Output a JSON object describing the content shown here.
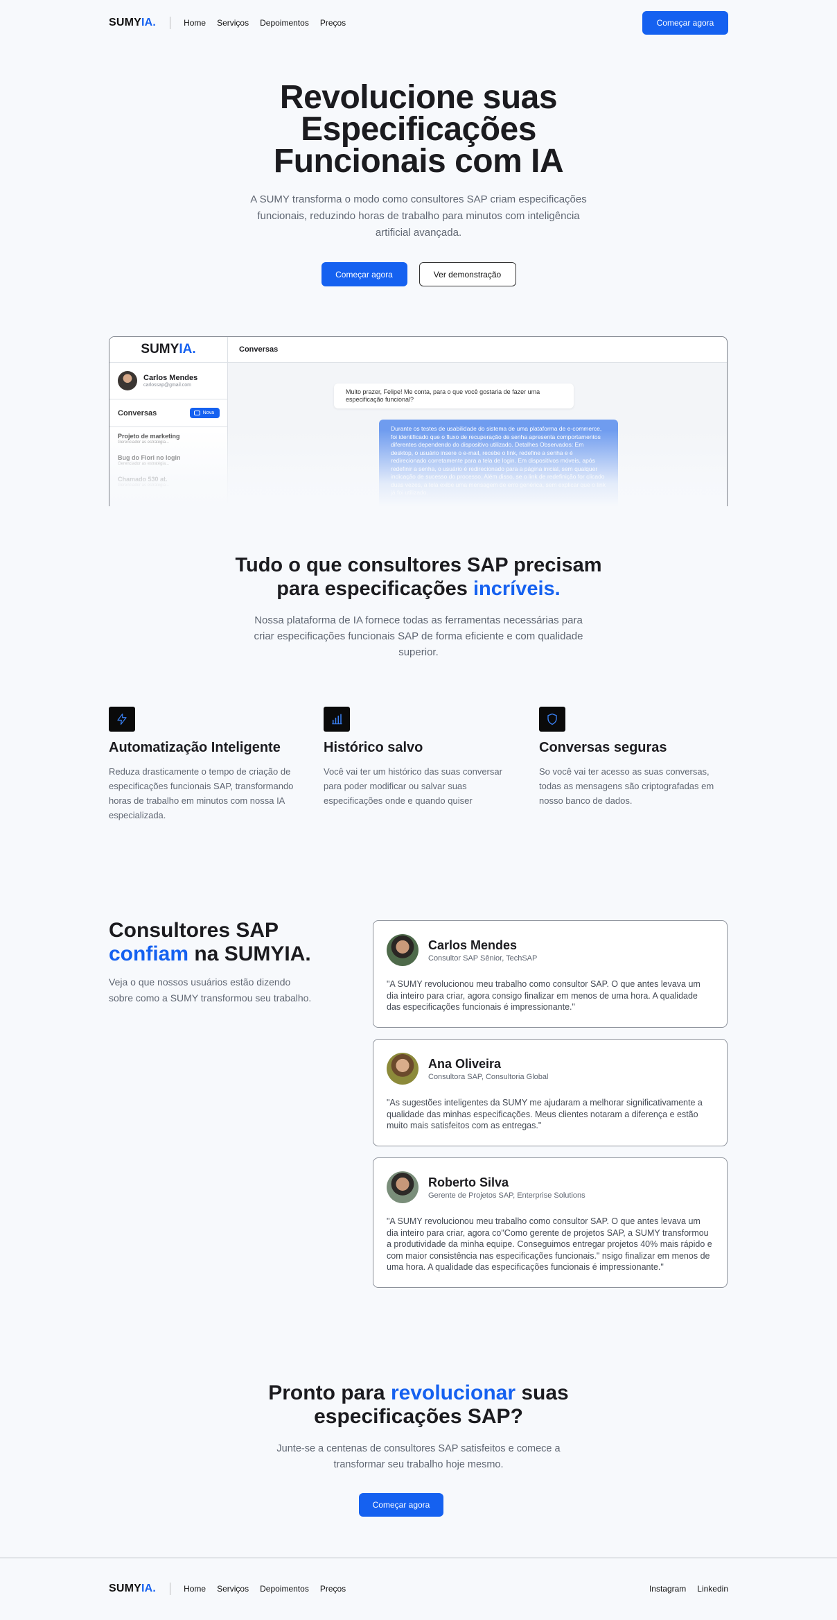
{
  "brand": {
    "name_main": "SUMY",
    "name_accent": "IA."
  },
  "colors": {
    "accent": "#1561f0",
    "background": "#f7f9fc",
    "text": "#1b1b1f",
    "muted": "#5f6672"
  },
  "nav": {
    "links": [
      "Home",
      "Serviços",
      "Depoimentos",
      "Preços"
    ],
    "cta": "Começar agora"
  },
  "hero": {
    "title_line1": "Revolucione suas",
    "title_line2": "Especificações",
    "title_line3": "Funcionais com IA",
    "subtitle": "A SUMY transforma o modo como consultores SAP criam especificações funcionais, reduzindo horas de trabalho para minutos com inteligência artificial avançada.",
    "primary_button": "Começar agora",
    "secondary_button": "Ver demonstração"
  },
  "app_preview": {
    "logo_main": "SUMY",
    "logo_accent": "IA.",
    "header_title": "Conversas",
    "user": {
      "name": "Carlos Mendes",
      "email": "carlossap@gmail.com"
    },
    "conversations_label": "Conversas",
    "new_button": "Nova",
    "conversations": [
      {
        "title": "Projeto de marketing",
        "desc": "Gerenciador as estratégia..."
      },
      {
        "title": "Bug do Fiori no login",
        "desc": "Gerenciador as estratégia..."
      },
      {
        "title": "Chamado 530 at.",
        "desc": "Gerenciador as estratégia..."
      }
    ],
    "message_in": "Muito prazer, Felipe! Me conta, para o que você gostaria de fazer uma especificação funcional?",
    "message_out": "Durante os testes de usabilidade do sistema de uma plataforma de e-commerce, foi identificado que o fluxo de recuperação de senha apresenta comportamentos diferentes dependendo do dispositivo utilizado. Detalhes Observados: Em desktop, o usuário insere o e-mail, recebe o link, redefine a senha e é redirecionado corretamente para a tela de login. Em dispositivos móveis, após redefinir a senha, o usuário é redirecionado para a página inicial, sem qualquer indicação de sucesso do processo. Além disso, se o link de redefinição for clicado duas vezes, a tela exibe uma mensagem de erro genérica, sem explicar que o link já foi utilizado."
  },
  "features_section": {
    "title_line1": "Tudo o que consultores SAP precisam",
    "title_line2_prefix": "para especificações ",
    "title_line2_accent": "incríveis.",
    "subtitle": "Nossa plataforma de IA fornece todas as ferramentas necessárias para criar especificações funcionais SAP de forma eficiente e com qualidade superior.",
    "items": [
      {
        "icon": "lightning-icon",
        "title": "Automatização Inteligente",
        "text": "Reduza drasticamente o tempo de criação de especificações funcionais SAP, transformando horas de trabalho em minutos com nossa IA especializada."
      },
      {
        "icon": "bar-chart-icon",
        "title": "Histórico salvo",
        "text": "Você vai ter um histórico das suas conversar para poder modificar ou salvar suas especificações onde e quando quiser"
      },
      {
        "icon": "shield-icon",
        "title": "Conversas seguras",
        "text": "So você vai ter acesso as suas conversas, todas as mensagens são criptografadas em nosso banco de dados."
      }
    ]
  },
  "testimonials": {
    "title_line1": "Consultores SAP",
    "title_accent": "confiam",
    "title_line2_rest": " na SUMYIA.",
    "subtitle": "Veja o que nossos usuários estão dizendo sobre como a SUMY transformou seu trabalho.",
    "items": [
      {
        "name": "Carlos Mendes",
        "role": "Consultor SAP Sênior, TechSAP",
        "quote": "\"A SUMY revolucionou meu trabalho como consultor SAP. O que antes levava um dia inteiro para criar, agora consigo finalizar em menos de uma hora. A qualidade das especificações funcionais é impressionante.\""
      },
      {
        "name": "Ana Oliveira",
        "role": "Consultora SAP, Consultoria Global",
        "quote": "\"As sugestões inteligentes da SUMY me ajudaram a melhorar significativamente a qualidade das minhas especificações. Meus clientes notaram a diferença e estão muito mais satisfeitos com as entregas.\""
      },
      {
        "name": "Roberto Silva",
        "role": "Gerente de Projetos SAP, Enterprise Solutions",
        "quote": "\"A SUMY revolucionou meu trabalho como consultor SAP. O que antes levava um dia inteiro para criar, agora co\"Como gerente de projetos SAP, a SUMY transformou a produtividade da minha equipe. Conseguimos entregar projetos 40% mais rápido e com maior consistência nas especificações funcionais.\" nsigo finalizar em menos de uma hora. A qualidade das especificações funcionais é impressionante.\""
      }
    ]
  },
  "cta_section": {
    "title_prefix": "Pronto para ",
    "title_accent": "revolucionar",
    "title_suffix": " suas",
    "title_line2": "especificações SAP?",
    "subtitle": "Junte-se a centenas de consultores SAP satisfeitos e comece a transformar seu trabalho hoje mesmo.",
    "button": "Começar agora"
  },
  "footer": {
    "links": [
      "Home",
      "Serviços",
      "Depoimentos",
      "Preços"
    ],
    "social": [
      "Instagram",
      "Linkedin"
    ]
  }
}
